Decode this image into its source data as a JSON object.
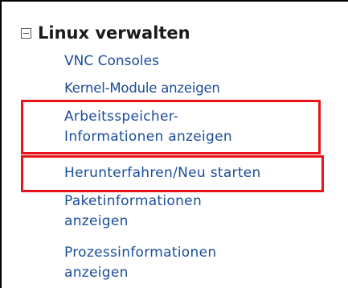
{
  "section": {
    "title": "Linux verwalten",
    "icon": "collapse-icon"
  },
  "menu": {
    "vnc_consoles": "VNC Consoles",
    "kernel_modules": "Kernel-Module anzeigen",
    "memory_info_line1": "Arbeitsspeicher-",
    "memory_info_line2": "Informationen anzeigen",
    "shutdown_restart": "Herunterfahren/Neu starten",
    "package_info_line1": "Paketinformationen",
    "package_info_line2": "anzeigen",
    "process_info_line1": "Prozessinformationen",
    "process_info_line2": "anzeigen"
  },
  "colors": {
    "link": "#1a4d9a",
    "highlight": "#e8141b",
    "title": "#1a1a1a"
  }
}
